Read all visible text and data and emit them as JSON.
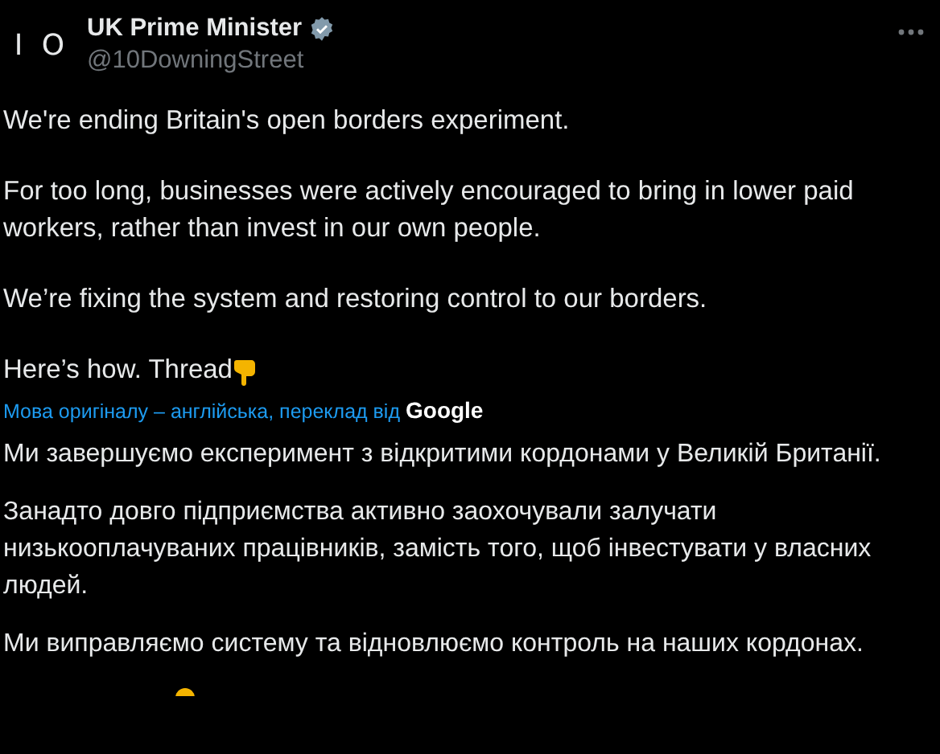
{
  "author": {
    "name": "UK Prime Minister",
    "verified": true,
    "handle": "@10DowningStreet",
    "avatar_text": "I O"
  },
  "paragraphs": [
    "We're ending Britain's open borders experiment.",
    "For too long, businesses were actively encouraged to bring in lower paid workers, rather than invest in our own people.",
    "We’re fixing the system and restoring control to our borders.",
    "Here’s how. Thread"
  ],
  "translation": {
    "note": "Мова оригіналу – англійська, переклад від",
    "provider": "Google"
  },
  "translated_paragraphs": [
    "Ми завершуємо експеримент з відкритими кордонами у Великій Британії.",
    "Занадто довго підприємства активно заохочували залучати низькооплачуваних працівників, замість того, щоб інвестувати у власних людей.",
    "Ми виправляємо систему та відновлюємо контроль на наших кордонах."
  ]
}
